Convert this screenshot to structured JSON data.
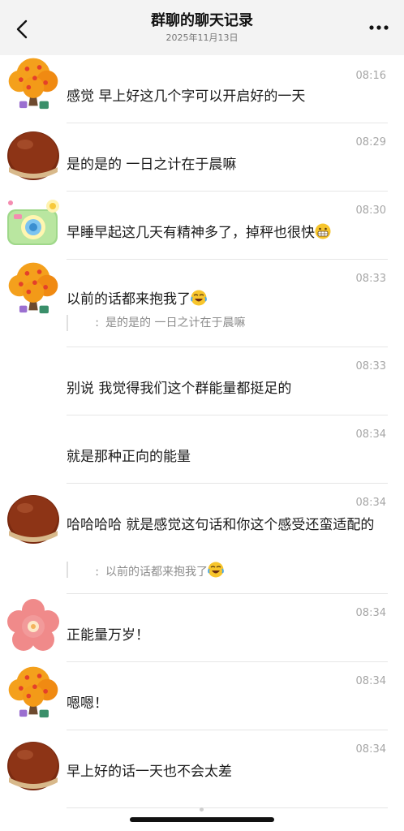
{
  "header": {
    "title": "群聊的聊天记录",
    "date": "2025年11月13日",
    "back_icon": "chevron-left-icon",
    "more_icon": "ellipsis-icon"
  },
  "colors": {
    "header_bg": "#f3f3f3",
    "time": "#a6a6a6",
    "divider": "#e6e6e6",
    "quote_text": "#8c8c8c"
  },
  "messages": [
    {
      "avatar": "tree-avatar",
      "time": "08:16",
      "text": "感觉 早上好这几个字可以开启好的一天"
    },
    {
      "avatar": "chestnut-avatar",
      "time": "08:29",
      "text": "是的是的 一日之计在于晨嘛"
    },
    {
      "avatar": "camera-avatar",
      "time": "08:30",
      "text": "早睡早起这几天有精神多了，掉秤也很快",
      "emoji": "grin-icon"
    },
    {
      "avatar": "tree-avatar",
      "time": "08:33",
      "text": "以前的话都来抱我了",
      "emoji": "laugh-tears-icon",
      "quote": "是的是的 一日之计在于晨嘛"
    },
    {
      "avatar": "",
      "time": "08:33",
      "text": "别说 我觉得我们这个群能量都挺足的"
    },
    {
      "avatar": "",
      "time": "08:34",
      "text": "就是那种正向的能量"
    },
    {
      "avatar": "chestnut-avatar",
      "time": "08:34",
      "text": "哈哈哈哈 就是感觉这句话和你这个感受还蛮适配的",
      "quote": "以前的话都来抱我了",
      "quote_emoji": "laugh-tears-icon"
    },
    {
      "avatar": "flower-avatar",
      "time": "08:34",
      "text": "正能量万岁！"
    },
    {
      "avatar": "tree-avatar",
      "time": "08:34",
      "text": "嗯嗯！"
    },
    {
      "avatar": "chestnut-avatar",
      "time": "08:34",
      "text": "早上好的话一天也不会太差"
    }
  ]
}
